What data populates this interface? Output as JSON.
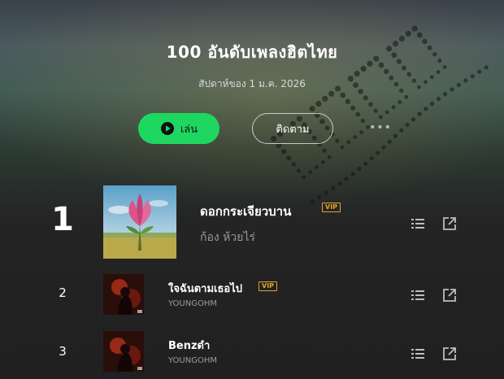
{
  "header": {
    "title": "100 อันดับเพลงฮิตไทย",
    "subtitle": "สัปดาห์ของ 1 ม.ค. 2026"
  },
  "actions": {
    "play_label": "เล่น",
    "follow_label": "ติดตาม",
    "more_label": "•••"
  },
  "tracks": [
    {
      "rank": "1",
      "title": "ดอกกระเจียวบาน",
      "artist": "ก้อง ห้วยไร่",
      "vip": "VIP"
    },
    {
      "rank": "2",
      "title": "ใจฉันตามเธอไป",
      "artist": "YOUNGOHM",
      "vip": "VIP"
    },
    {
      "rank": "3",
      "title": "Benzดำ",
      "artist": "YOUNGOHM"
    }
  ],
  "colors": {
    "accent": "#1ed760",
    "vip": "#e2a32a",
    "background": "#1f1f1f"
  },
  "icons": [
    "play-icon",
    "more-icon",
    "queue-icon",
    "share-icon"
  ]
}
